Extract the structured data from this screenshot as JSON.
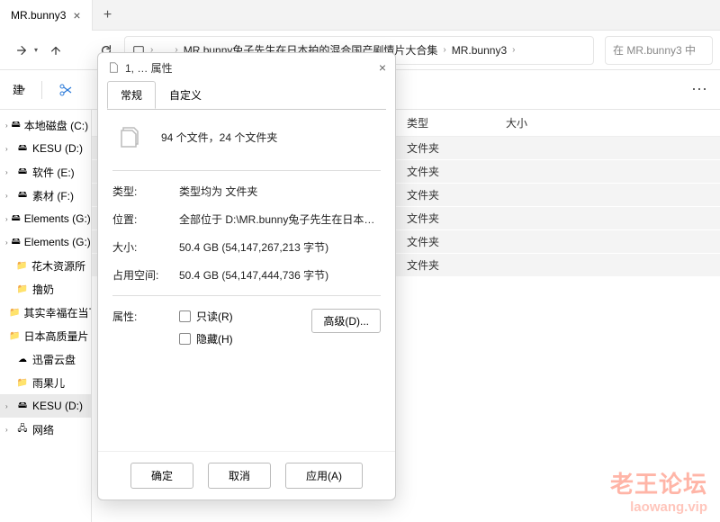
{
  "tab": {
    "title": "MR.bunny3"
  },
  "breadcrumb": {
    "ellipsis": "…",
    "seg1": "MR.bunny兔子先生在日本拍的混合国产剧情片大合集",
    "seg2": "MR.bunny3"
  },
  "search": {
    "placeholder": "在 MR.bunny3 中"
  },
  "cmd": {
    "new_label": "建"
  },
  "sidebar": {
    "items": [
      "本地磁盘 (C:)",
      "KESU (D:)",
      "软件 (E:)",
      "素材 (F:)",
      "Elements (G:)",
      "Elements (G:)",
      "花木资源所",
      "撸奶",
      "其实幸福在当下",
      "日本高质量片",
      "迅雷云盘",
      "雨果儿",
      "KESU (D:)",
      "网络"
    ]
  },
  "columns": {
    "type": "类型",
    "size": "大小"
  },
  "rows": [
    {
      "type": "文件夹"
    },
    {
      "type": "文件夹"
    },
    {
      "type": "文件夹"
    },
    {
      "type": "文件夹"
    },
    {
      "type": "文件夹"
    },
    {
      "type": "文件夹"
    }
  ],
  "dialog": {
    "title": "1, … 属性",
    "tabs": {
      "general": "常规",
      "custom": "自定义"
    },
    "summary": "94 个文件，24 个文件夹",
    "type_label": "类型:",
    "type_value": "类型均为 文件夹",
    "location_label": "位置:",
    "location_value": "全部位于 D:\\MR.bunny兔子先生在日本拍的混合国产剧",
    "size_label": "大小:",
    "size_value": "50.4 GB (54,147,267,213 字节)",
    "sizeondisk_label": "占用空间:",
    "sizeondisk_value": "50.4 GB (54,147,444,736 字节)",
    "attr_label": "属性:",
    "readonly": "只读(R)",
    "hidden": "隐藏(H)",
    "advanced": "高级(D)...",
    "ok": "确定",
    "cancel": "取消",
    "apply": "应用(A)"
  },
  "watermark": {
    "line1": "老王论坛",
    "line2": "laowang.vip"
  }
}
